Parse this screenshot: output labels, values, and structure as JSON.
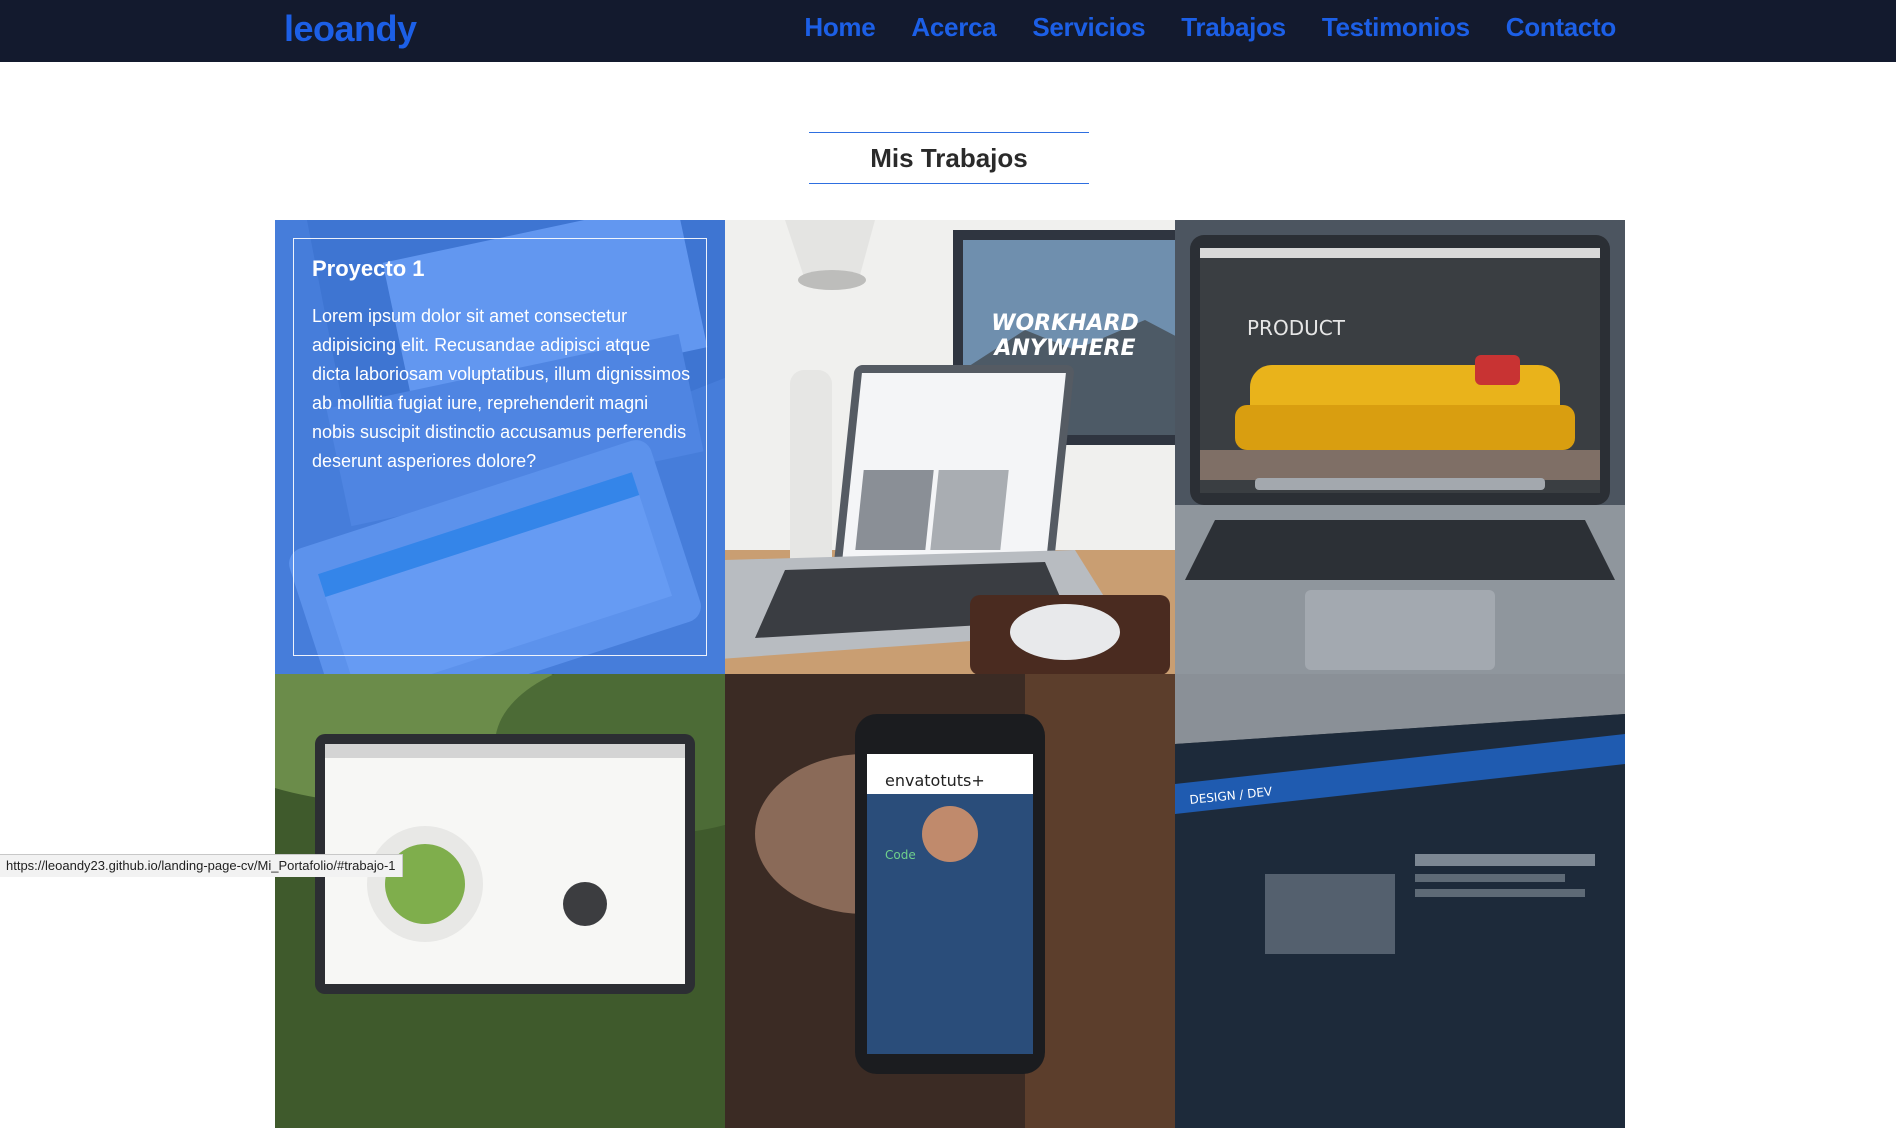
{
  "navbar": {
    "brand": "leoandy",
    "links": [
      "Home",
      "Acerca",
      "Servicios",
      "Trabajos",
      "Testimonios",
      "Contacto"
    ]
  },
  "section": {
    "title": "Mis Trabajos"
  },
  "projects": [
    {
      "title": "Proyecto 1",
      "description": "Lorem ipsum dolor sit amet consectetur adipisicing elit. Recusandae adipisci atque dicta laboriosam voluptatibus, illum dignissimos ab mollitia fugiat iure, reprehenderit magni nobis suscipit distinctio accusamus perferendis deserunt asperiores dolore?"
    }
  ],
  "thumbnails": {
    "photo_2_word_1": "WORKHARD",
    "photo_2_word_2": "ANYWHERE",
    "photo_3_label": "PRODUCT",
    "photo_5_brand": "envatotuts+",
    "photo_5_code": "Code",
    "photo_6_menu": "DESIGN / DEV"
  },
  "status_bar": {
    "url": "https://leoandy23.github.io/landing-page-cv/Mi_Portafolio/#trabajo-1"
  },
  "colors": {
    "navbar_bg": "#131a2e",
    "accent": "#1c5fe6",
    "overlay": "#3278f0"
  }
}
